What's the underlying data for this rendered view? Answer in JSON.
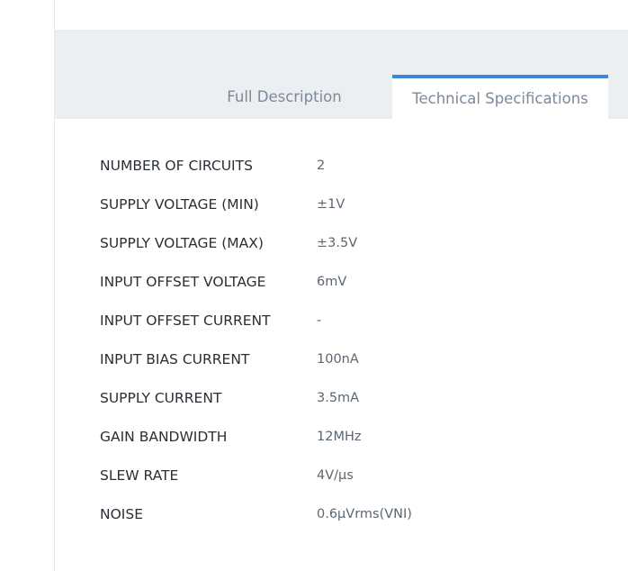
{
  "tabs": {
    "full_description": "Full Description",
    "technical_specifications": "Technical Specifications"
  },
  "specs": [
    {
      "label": "NUMBER OF CIRCUITS",
      "value": "2"
    },
    {
      "label": "SUPPLY VOLTAGE (MIN)",
      "value": "±1V"
    },
    {
      "label": "SUPPLY VOLTAGE (MAX)",
      "value": "±3.5V"
    },
    {
      "label": "INPUT OFFSET VOLTAGE",
      "value": "6mV"
    },
    {
      "label": "INPUT OFFSET CURRENT",
      "value": "-"
    },
    {
      "label": "INPUT BIAS CURRENT",
      "value": "100nA"
    },
    {
      "label": "SUPPLY CURRENT",
      "value": "3.5mA"
    },
    {
      "label": "GAIN BANDWIDTH",
      "value": "12MHz"
    },
    {
      "label": "SLEW RATE",
      "value": "4V/µs"
    },
    {
      "label": "NOISE",
      "value": "0.6µVrms(VNI)"
    }
  ],
  "colors": {
    "tab_bar_bg": "#eceff2",
    "active_tab_accent": "#3a87d6",
    "label_text": "#2a2f35",
    "value_text": "#5c6670"
  }
}
